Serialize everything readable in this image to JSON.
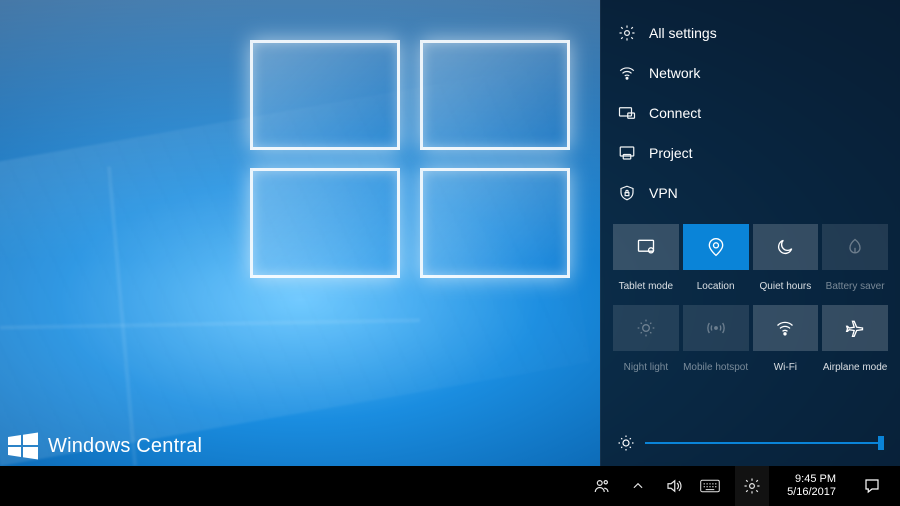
{
  "watermark": {
    "text": "Windows Central"
  },
  "action_center": {
    "menu": [
      {
        "icon": "gear-icon",
        "label": "All settings"
      },
      {
        "icon": "wifi-icon",
        "label": "Network"
      },
      {
        "icon": "connect-icon",
        "label": "Connect"
      },
      {
        "icon": "project-icon",
        "label": "Project"
      },
      {
        "icon": "vpn-icon",
        "label": "VPN"
      }
    ],
    "tiles_row1": [
      {
        "icon": "tablet-icon",
        "label": "Tablet mode",
        "state": "normal"
      },
      {
        "icon": "location-icon",
        "label": "Location",
        "state": "active"
      },
      {
        "icon": "moon-icon",
        "label": "Quiet hours",
        "state": "normal"
      },
      {
        "icon": "battery-leaf-icon",
        "label": "Battery saver",
        "state": "dim"
      }
    ],
    "tiles_row2": [
      {
        "icon": "sun-icon",
        "label": "Night light",
        "state": "dim"
      },
      {
        "icon": "hotspot-icon",
        "label": "Mobile hotspot",
        "state": "dim"
      },
      {
        "icon": "wifi-icon",
        "label": "Wi-Fi",
        "state": "normal"
      },
      {
        "icon": "airplane-icon",
        "label": "Airplane mode",
        "state": "normal"
      }
    ],
    "brightness_percent": 100
  },
  "taskbar": {
    "tray": [
      {
        "icon": "people-icon"
      },
      {
        "icon": "chevron-up-icon"
      },
      {
        "icon": "volume-icon"
      },
      {
        "icon": "keyboard-icon"
      },
      {
        "icon": "gear-icon"
      }
    ],
    "clock": {
      "time": "9:45 PM",
      "date": "5/16/2017"
    }
  }
}
